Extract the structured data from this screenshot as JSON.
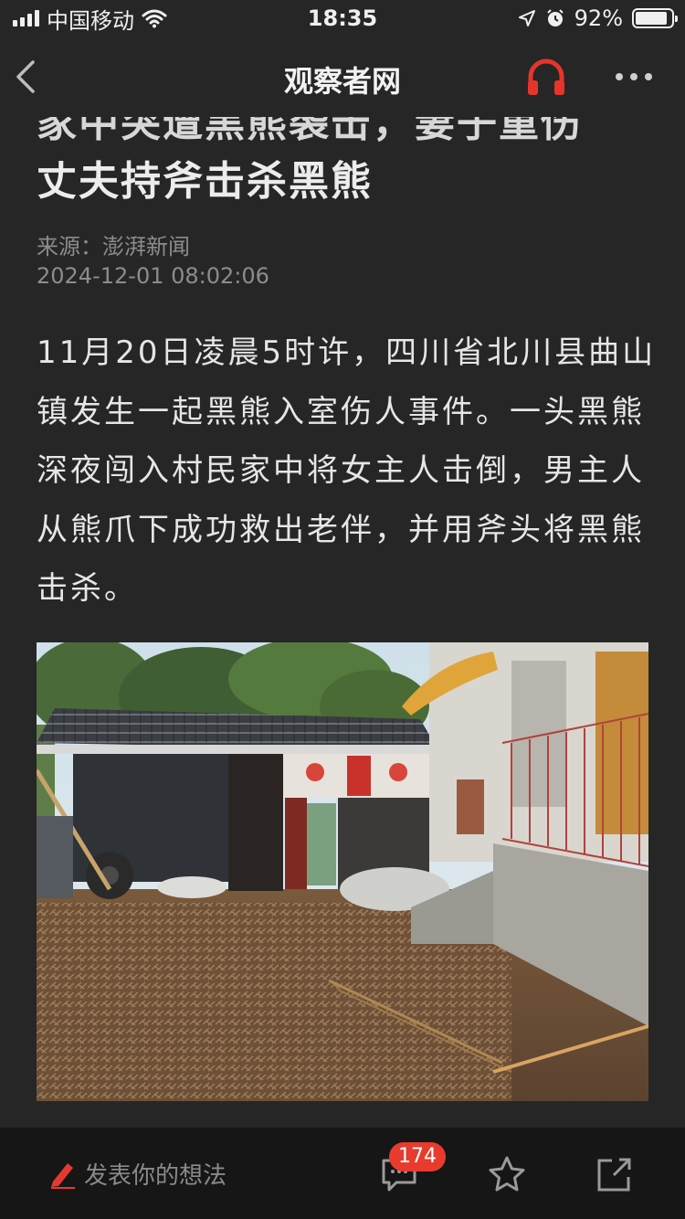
{
  "status_bar": {
    "carrier": "中国移动",
    "time": "18:35",
    "battery": "92%",
    "battery_level": 0.92
  },
  "navbar": {
    "title": "观察者网",
    "accent_color": "#e5352b"
  },
  "article": {
    "title_partial_line": "家中突遭黑熊袭击，妻子重伤",
    "title_line": "丈夫持斧击杀黑熊",
    "source": "来源：澎湃新闻",
    "datetime": "2024-12-01 08:02:06",
    "body": "11月20日凌晨5时许，四川省北川县曲山镇发生一起黑熊入室伤人事件。一头黑熊深夜闯入村民家中将女主人击倒，男主人从熊爪下成功救出老伴，并用斧头将黑熊击杀。",
    "image": "photo of rural courtyard with tiled-roof shed and scattered straw"
  },
  "bottom_bar": {
    "comment_placeholder": "发表你的想法",
    "comment_count": "174",
    "icons": [
      "edit-icon",
      "comment-icon",
      "star-icon",
      "share-icon"
    ]
  }
}
